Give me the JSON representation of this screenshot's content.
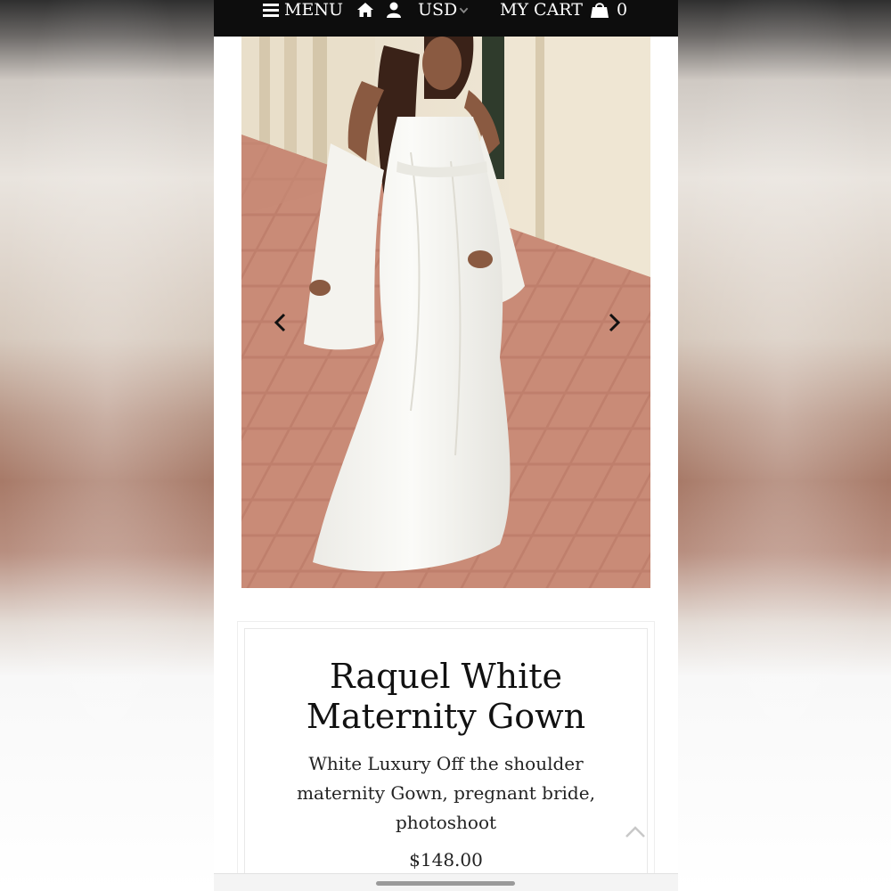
{
  "nav": {
    "menu_label": "MENU",
    "currency_label": "USD",
    "cart_label": "MY CART",
    "cart_count": "0"
  },
  "product": {
    "title": "Raquel White Maternity Gown",
    "description": "White Luxury Off the shoulder maternity Gown, pregnant bride, photoshoot",
    "price": "$148.00"
  },
  "icons": {
    "menu": "hamburger-icon",
    "home": "home-icon",
    "account": "user-icon",
    "currency_dropdown": "chevron-down-icon",
    "cart": "shopping-bag-icon",
    "gallery_prev": "chevron-left-icon",
    "gallery_next": "chevron-right-icon",
    "scroll_top": "chevron-up-icon"
  },
  "colors": {
    "topbar": "#0d0d0d",
    "text": "#111111",
    "page": "#ffffff"
  }
}
